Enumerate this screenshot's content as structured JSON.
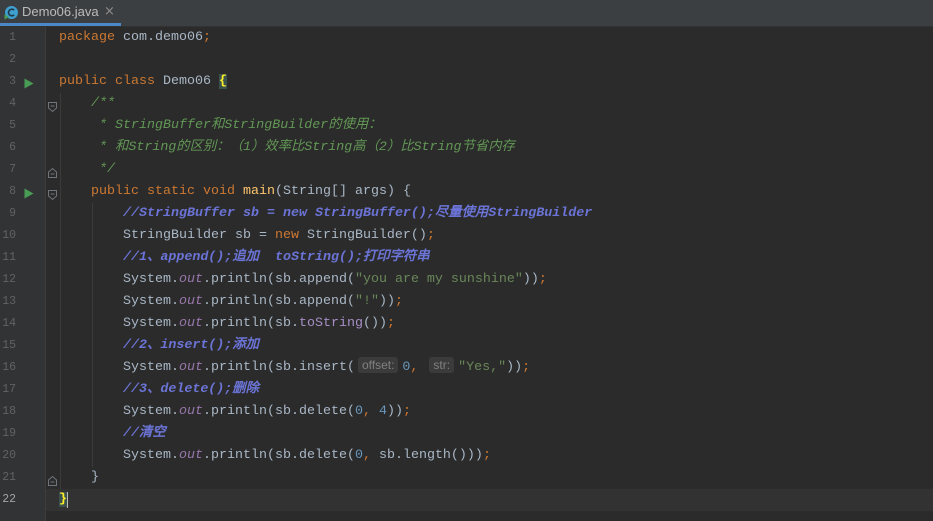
{
  "tab": {
    "filename": "Demo06.java",
    "close": "×",
    "icon": "java-class-icon"
  },
  "gutter": {
    "line_numbers": [
      "1",
      "2",
      "3",
      "4",
      "5",
      "6",
      "7",
      "8",
      "9",
      "10",
      "11",
      "12",
      "13",
      "14",
      "15",
      "16",
      "17",
      "18",
      "19",
      "20",
      "21",
      "22"
    ],
    "run_lines": [
      3,
      8
    ],
    "fold_open_lines": [
      4,
      8
    ],
    "fold_close_lines": [
      7,
      21
    ],
    "run_icon": "run-triangle-icon",
    "fold_icon": "fold-toggle-icon"
  },
  "editor": {
    "current_line": 22,
    "lines": [
      [
        {
          "keyword": "package"
        },
        {
          "text": " com.demo06"
        },
        {
          "punct": ";"
        }
      ],
      [],
      [
        {
          "keyword": "public"
        },
        {
          "text": " "
        },
        {
          "keyword": "class"
        },
        {
          "text": " Demo06 "
        },
        {
          "brace_match": "{"
        }
      ],
      [
        {
          "text": "    "
        },
        {
          "doc_comment": "/**"
        }
      ],
      [
        {
          "text": "    "
        },
        {
          "doc_comment": " * StringBuffer和StringBuilder的使用："
        }
      ],
      [
        {
          "text": "    "
        },
        {
          "doc_comment": " * 和String的区别：（1）效率比String高（2）比String节省内存"
        }
      ],
      [
        {
          "text": "    "
        },
        {
          "doc_comment": " */"
        }
      ],
      [
        {
          "text": "    "
        },
        {
          "keyword": "public"
        },
        {
          "text": " "
        },
        {
          "keyword": "static"
        },
        {
          "text": " "
        },
        {
          "keyword": "void"
        },
        {
          "text": " "
        },
        {
          "method_decl": "main"
        },
        {
          "text": "(String[] args) {"
        }
      ],
      [
        {
          "text": "        "
        },
        {
          "line_comment": "//StringBuffer sb = new StringBuffer();尽量使用StringBuilder"
        }
      ],
      [
        {
          "text": "        StringBuilder sb = "
        },
        {
          "keyword": "new"
        },
        {
          "text": " StringBuilder()"
        },
        {
          "punct": ";"
        }
      ],
      [
        {
          "text": "        "
        },
        {
          "line_comment": "//1、append();追加  toString();打印字符串"
        }
      ],
      [
        {
          "text": "        System."
        },
        {
          "static_field": "out"
        },
        {
          "text": ".println(sb.append("
        },
        {
          "string": "\"you are my sunshine\""
        },
        {
          "text": "))"
        },
        {
          "punct": ";"
        }
      ],
      [
        {
          "text": "        System."
        },
        {
          "static_field": "out"
        },
        {
          "text": ".println(sb.append("
        },
        {
          "string": "\"!\""
        },
        {
          "text": "))"
        },
        {
          "punct": ";"
        }
      ],
      [
        {
          "text": "        System."
        },
        {
          "static_field": "out"
        },
        {
          "text": ".println(sb."
        },
        {
          "redundant_call": "toString"
        },
        {
          "text": "())"
        },
        {
          "punct": ";"
        }
      ],
      [
        {
          "text": "        "
        },
        {
          "line_comment": "//2、insert();添加"
        }
      ],
      [
        {
          "text": "        System."
        },
        {
          "static_field": "out"
        },
        {
          "text": ".println(sb.insert("
        },
        {
          "param_hint": "offset:"
        },
        {
          "number": "0"
        },
        {
          "punct": ","
        },
        {
          "text": " "
        },
        {
          "param_hint": "str:"
        },
        {
          "string": "\"Yes,\""
        },
        {
          "text": "))"
        },
        {
          "punct": ";"
        }
      ],
      [
        {
          "text": "        "
        },
        {
          "line_comment": "//3、delete();删除"
        }
      ],
      [
        {
          "text": "        System."
        },
        {
          "static_field": "out"
        },
        {
          "text": ".println(sb.delete("
        },
        {
          "number": "0"
        },
        {
          "punct": ","
        },
        {
          "text": " "
        },
        {
          "number": "4"
        },
        {
          "text": "))"
        },
        {
          "punct": ";"
        }
      ],
      [
        {
          "text": "        "
        },
        {
          "line_comment": "//清空"
        }
      ],
      [
        {
          "text": "        System."
        },
        {
          "static_field": "out"
        },
        {
          "text": ".println(sb.delete("
        },
        {
          "number": "0"
        },
        {
          "punct": ","
        },
        {
          "text": " sb.length()))"
        },
        {
          "punct": ";"
        }
      ],
      [
        {
          "text": "    }"
        }
      ],
      [
        {
          "brace_match": "}"
        }
      ]
    ]
  },
  "theme": {
    "editor_bg": "#2b2b2b",
    "tabbar_bg": "#3c3f41",
    "accent": "#4a88c7",
    "tab_text": "#bbbbbb",
    "tab_close": "#8c8c8c",
    "gutter_bg": "#313335",
    "line_no": "#606366",
    "line_no_current": "#a4a3a3",
    "current_line_bg": "#323232",
    "indent_guide": "#3b3b3b",
    "run": "#499c54",
    "fold": "#6f737a",
    "caret": "#bbbbbb",
    "txt": "#a9b7c6",
    "kw": "#cc7832",
    "str": "#6a8759",
    "num": "#6897bb",
    "doc": "#629755",
    "cmt": "#6b74d6",
    "fn": "#ffc66d",
    "fld": "#9876aa",
    "call": "#a68fc5",
    "hint_bg": "#3b3b3b",
    "hint_fg": "#808080",
    "brace_bg": "#3b514d",
    "brace_fg": "#ffef28"
  }
}
